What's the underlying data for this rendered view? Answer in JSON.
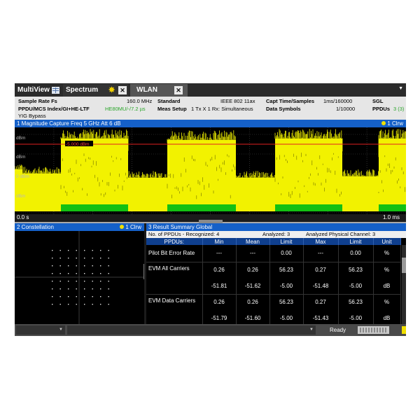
{
  "tabs": [
    {
      "label": "MultiView",
      "icon": "grid-icon"
    },
    {
      "label": "Spectrum",
      "icon": "star-icon"
    },
    {
      "label": "WLAN"
    }
  ],
  "close_glyph": "✕",
  "info": {
    "sample_rate_label": "Sample Rate Fs",
    "sample_rate_value": "160.0 MHz",
    "standard_label": "Standard",
    "standard_value": "IEEE 802 11ax",
    "capt_label": "Capt Time/Samples",
    "capt_value": "1ms/160000",
    "mode": "SGL",
    "ppdu_label": "PPDU/MCS Index/GI+HE-LTF",
    "ppdu_value": "HE80MU/-/7.2 µs",
    "meas_setup_label": "Meas Setup",
    "meas_setup_value": "1 Tx X 1 Rx: Simultaneous",
    "data_symbols_label": "Data Symbols",
    "data_symbols_value": "1/10000",
    "ppdus_label": "PPDUs",
    "ppdus_value": "3 (3)",
    "yig": "YIG Bypass"
  },
  "magnitude": {
    "title": "1 Magnitude Capture  Freq 5 GHz Att 6 dB",
    "trace": "1 Clrw",
    "ref_label": "-5.000 dBm",
    "y_labels": [
      "dBm",
      "dBm",
      "0 dBm",
      "dBm"
    ],
    "x_start": "0.0 s",
    "x_end": "1.0 ms",
    "colors": {
      "trace": "#f2f200",
      "bar": "#13c013",
      "ref": "#e02020",
      "grid": "#4a4a4a"
    }
  },
  "constellation": {
    "title": "2 Constellation",
    "trace": "1 Clrw"
  },
  "summary": {
    "title": "3 Result Summary Global",
    "recognized": "No. of PPDUs - Recognized:  4",
    "analyzed": "Analyzed:  3",
    "analyzed_phys": "Analyzed Physical Channel:  3",
    "headers": [
      "PPDUs:",
      "Min",
      "Mean",
      "Limit",
      "Max",
      "Limit",
      "Unit"
    ],
    "rows": [
      {
        "label": "Pilot Bit Error Rate",
        "min": "---",
        "mean": "---",
        "limit1": "0.00",
        "max": "---",
        "limit2": "0.00",
        "unit": "%"
      },
      {
        "label": "EVM All Carriers",
        "min": "0.26",
        "mean": "0.26",
        "limit1": "56.23",
        "max": "0.27",
        "limit2": "56.23",
        "unit": "%"
      },
      {
        "label": "",
        "min": "-51.81",
        "mean": "-51.62",
        "limit1": "-5.00",
        "max": "-51.48",
        "limit2": "-5.00",
        "unit": "dB"
      },
      {
        "label": "EVM Data Carriers",
        "min": "0.26",
        "mean": "0.26",
        "limit1": "56.23",
        "max": "0.27",
        "limit2": "56.23",
        "unit": "%"
      },
      {
        "label": "",
        "min": "-51.79",
        "mean": "-51.60",
        "limit1": "-5.00",
        "max": "-51.43",
        "limit2": "-5.00",
        "unit": "dB"
      }
    ]
  },
  "status": {
    "ready": "Ready"
  }
}
